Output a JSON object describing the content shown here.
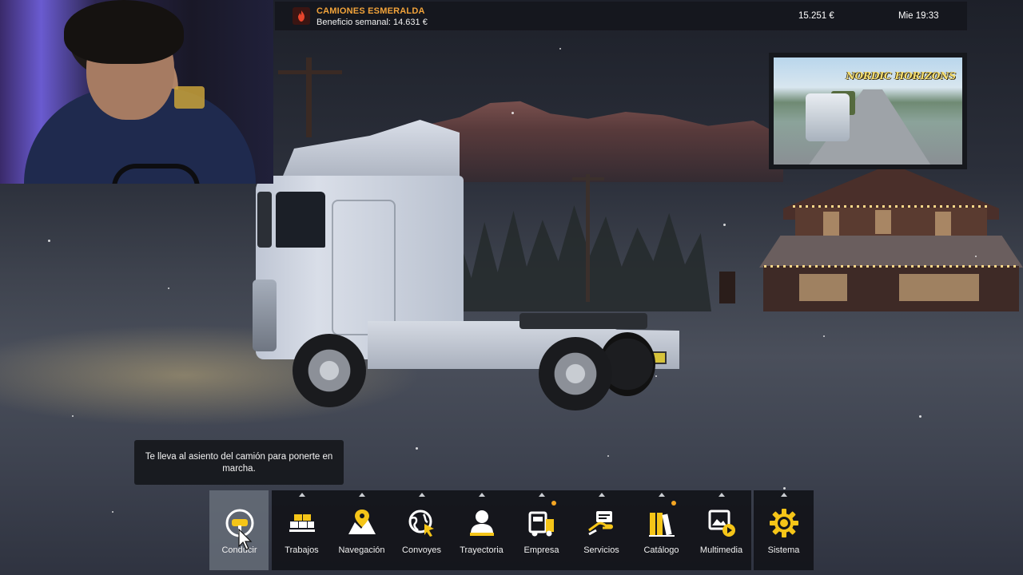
{
  "company": {
    "name": "CAMIONES ESMERALDA",
    "weekly_profit": "Beneficio semanal: 14.631 €",
    "money": "15.251 €",
    "clock": "Mie 19:33",
    "badge_icon": "company-logo-icon"
  },
  "promo": {
    "title": "NORDIC HORIZONS"
  },
  "tooltip": {
    "text": "Te lleva al asiento del camión para ponerte en marcha."
  },
  "dock": {
    "items": [
      {
        "label": "Conducir",
        "icon": "steering-wheel-icon",
        "active": true
      },
      {
        "label": "Trabajos",
        "icon": "cargo-pallets-icon",
        "notify": false
      },
      {
        "label": "Navegación",
        "icon": "map-pin-icon",
        "notify": false
      },
      {
        "label": "Convoyes",
        "icon": "globe-cursor-icon",
        "notify": false
      },
      {
        "label": "Trayectoria",
        "icon": "driver-profile-icon",
        "notify": false
      },
      {
        "label": "Empresa",
        "icon": "company-truck-icon",
        "notify": true
      },
      {
        "label": "Servicios",
        "icon": "service-hand-icon",
        "notify": false
      },
      {
        "label": "Catálogo",
        "icon": "catalog-books-icon",
        "notify": true
      },
      {
        "label": "Multimedia",
        "icon": "multimedia-icon",
        "notify": false
      },
      {
        "label": "Sistema",
        "icon": "gear-icon",
        "notify": false
      }
    ]
  },
  "colors": {
    "accent": "#f5a623",
    "company_name": "#f2a33a",
    "bar_bg": "#14161c"
  }
}
